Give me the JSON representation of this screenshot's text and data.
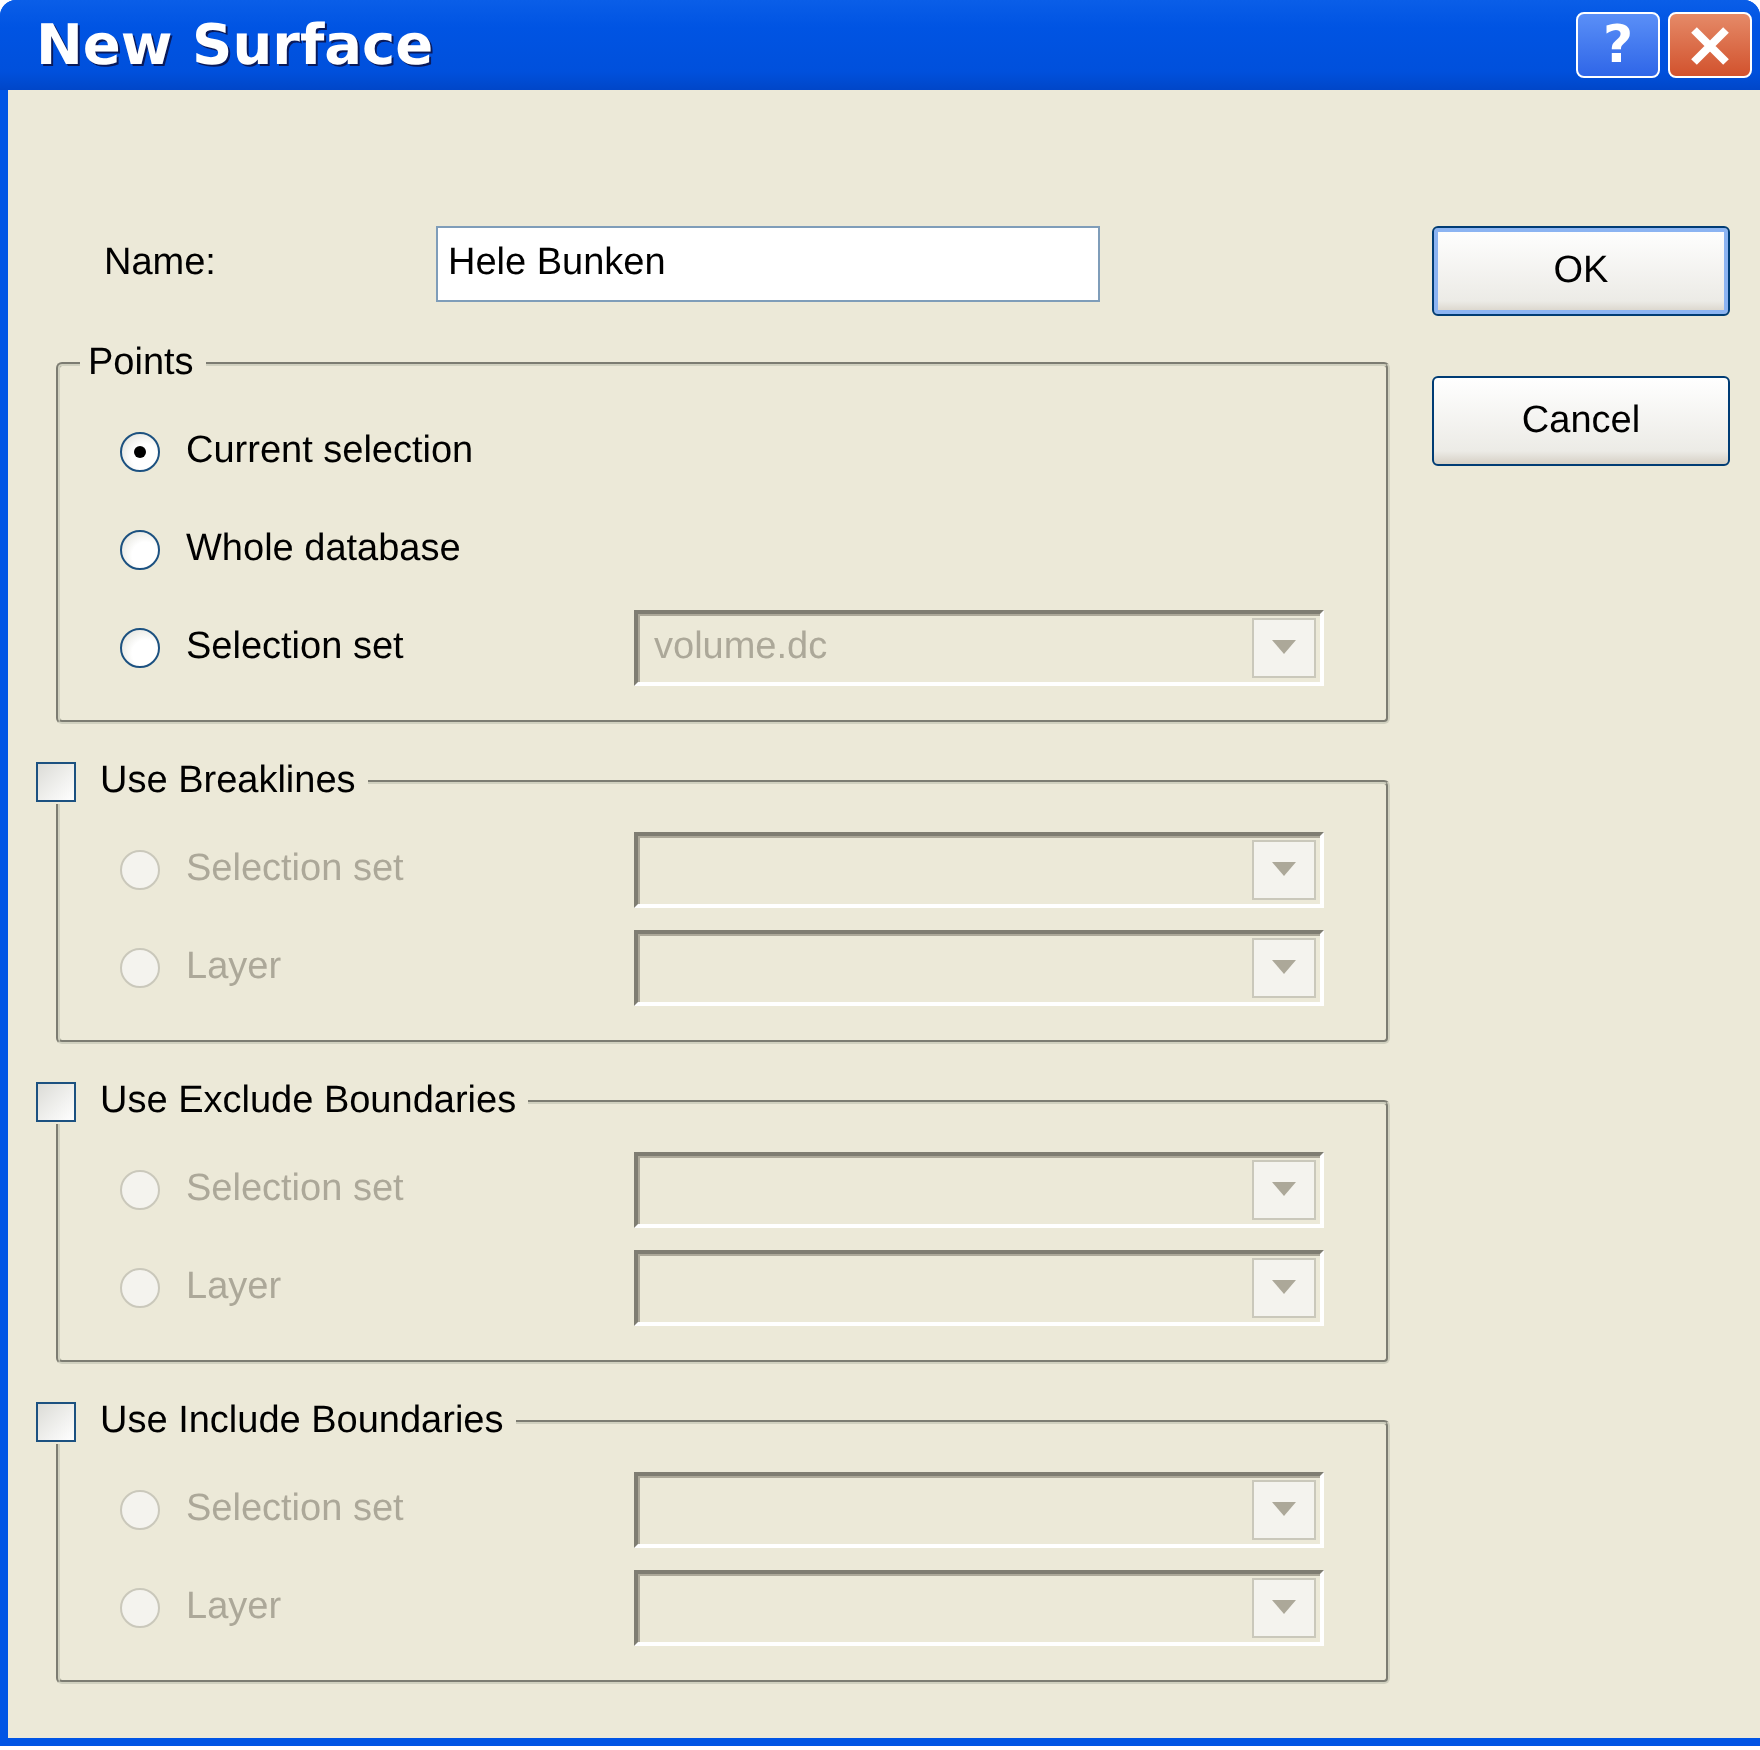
{
  "window": {
    "title": "New Surface",
    "help_button": "?"
  },
  "name_field": {
    "label": "Name:",
    "value": "Hele Bunken"
  },
  "buttons": [
    {
      "label": "OK",
      "default": true
    },
    {
      "label": "Cancel",
      "default": false
    }
  ],
  "groups": [
    {
      "kind": "plain",
      "title": "Points",
      "options": [
        {
          "label": "Current selection",
          "selected": true,
          "disabled": false
        },
        {
          "label": "Whole database",
          "selected": false,
          "disabled": false
        },
        {
          "label": "Selection set",
          "selected": false,
          "disabled": false,
          "combo": {
            "value": "volume.dc",
            "disabled": true
          }
        }
      ]
    },
    {
      "kind": "checkbox",
      "title": "Use Breaklines",
      "checked": false,
      "options": [
        {
          "label": "Selection set",
          "selected": false,
          "disabled": true,
          "combo": {
            "disabled": true
          }
        },
        {
          "label": "Layer",
          "selected": false,
          "disabled": true,
          "combo": {
            "disabled": true
          }
        }
      ]
    },
    {
      "kind": "checkbox",
      "title": "Use Exclude Boundaries",
      "checked": false,
      "options": [
        {
          "label": "Selection set",
          "selected": false,
          "disabled": true,
          "combo": {
            "disabled": true
          }
        },
        {
          "label": "Layer",
          "selected": false,
          "disabled": true,
          "combo": {
            "disabled": true
          }
        }
      ]
    },
    {
      "kind": "checkbox",
      "title": "Use Include Boundaries",
      "checked": false,
      "options": [
        {
          "label": "Selection set",
          "selected": false,
          "disabled": true,
          "combo": {
            "disabled": true
          }
        },
        {
          "label": "Layer",
          "selected": false,
          "disabled": true,
          "combo": {
            "disabled": true
          }
        }
      ]
    }
  ]
}
